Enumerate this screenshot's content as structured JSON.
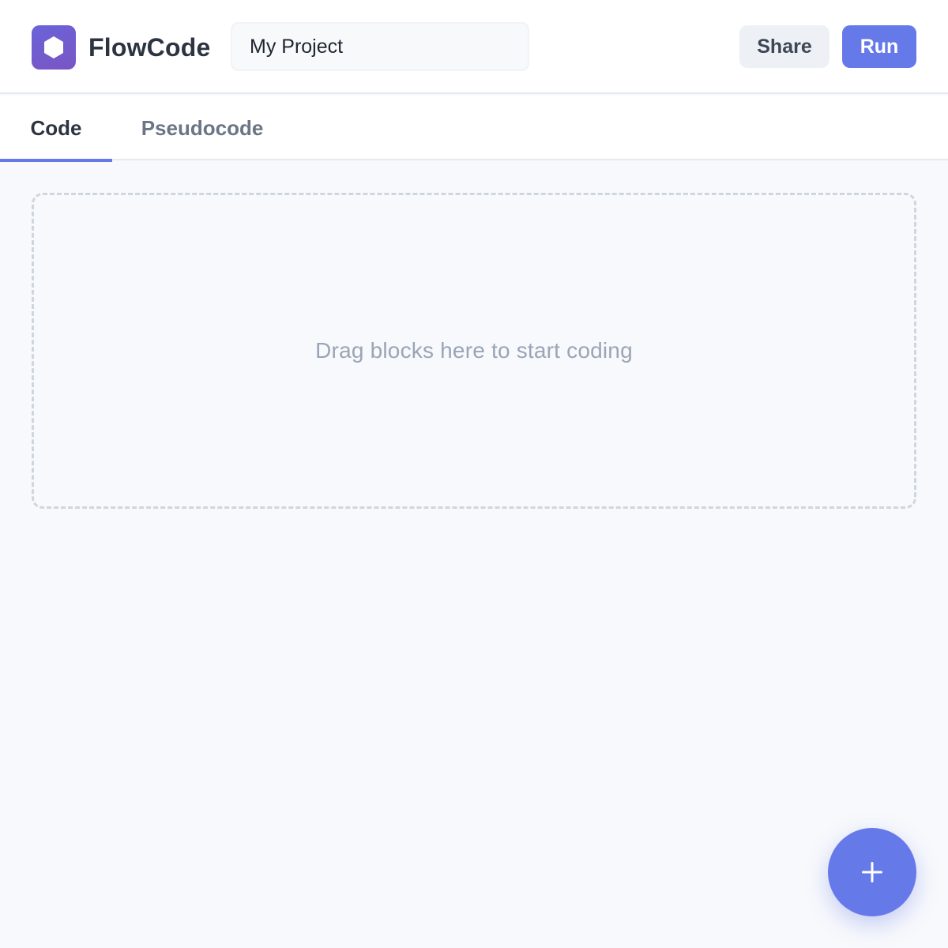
{
  "header": {
    "brand_name": "FlowCode",
    "logo_icon": "hexagon-icon",
    "project_name": "My Project",
    "share_label": "Share",
    "run_label": "Run"
  },
  "tabs": [
    {
      "label": "Code",
      "active": true
    },
    {
      "label": "Pseudocode",
      "active": false
    }
  ],
  "workspace": {
    "drop_zone_text": "Drag blocks here to start coding"
  },
  "fab": {
    "icon": "plus-icon"
  },
  "colors": {
    "accent": "#6679e9",
    "logo_gradient_start": "#6a63d9",
    "logo_gradient_end": "#7a55c4",
    "background": "#f7f9fc",
    "text_primary": "#2d3441",
    "text_muted": "#9aa5b5"
  }
}
